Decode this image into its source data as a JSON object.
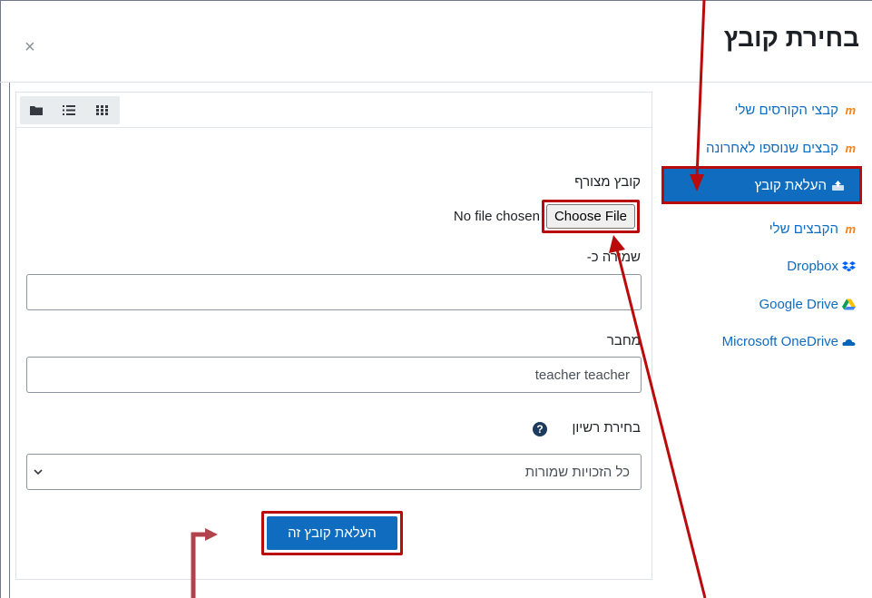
{
  "dialog": {
    "title": "בחירת קובץ",
    "close_symbol": "×"
  },
  "sidebar": {
    "items": [
      {
        "label": "קבצי הקורסים שלי",
        "icon": "moodle-icon"
      },
      {
        "label": "קבצים שנוספו לאחרונה",
        "icon": "moodle-icon"
      },
      {
        "label": "העלאת קובץ",
        "icon": "upload-icon",
        "active": true
      },
      {
        "label": "הקבצים שלי",
        "icon": "moodle-icon"
      },
      {
        "label": "Dropbox",
        "icon": "dropbox-icon"
      },
      {
        "label": "Google Drive",
        "icon": "google-drive-icon"
      },
      {
        "label": "Microsoft OneDrive",
        "icon": "onedrive-icon"
      }
    ]
  },
  "view_toggle": {
    "icons": [
      "folder-view-icon",
      "list-view-icon",
      "grid-view-icon"
    ]
  },
  "form": {
    "attachment_label": "קובץ מצורף",
    "no_file_text": "No file chosen",
    "choose_file_label": "Choose File",
    "save_as_label": "שמירה כ-",
    "save_as_value": "",
    "author_label": "מחבר",
    "author_value": "teacher teacher",
    "license_label": "בחירת רשיון",
    "license_value": "כל הזכויות שמורות",
    "upload_button_label": "העלאת קובץ זה"
  },
  "colors": {
    "accent": "#0f6cbf",
    "highlight": "#b90b0b",
    "moodle_orange": "#f98012"
  }
}
